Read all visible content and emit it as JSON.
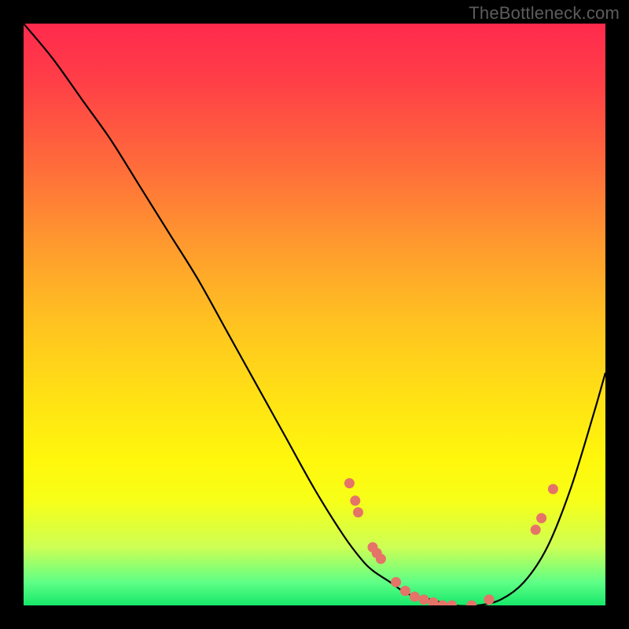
{
  "watermark": "TheBottleneck.com",
  "colors": {
    "background": "#000000",
    "gradient_top": "#ff2a4d",
    "gradient_bottom": "#17e86a",
    "curve": "#000000",
    "dots": "#e57368",
    "watermark_text": "#5c5c5c"
  },
  "chart_data": {
    "type": "line",
    "title": "",
    "xlabel": "",
    "ylabel": "",
    "xlim": [
      0,
      100
    ],
    "ylim": [
      0,
      100
    ],
    "x": [
      0,
      5,
      10,
      15,
      20,
      25,
      30,
      35,
      40,
      45,
      50,
      55,
      58,
      60,
      63,
      66,
      70,
      74,
      78,
      82,
      86,
      90,
      94,
      98,
      100
    ],
    "values": [
      100,
      94,
      87,
      80,
      72,
      64,
      56,
      47,
      38,
      29,
      20,
      12,
      8,
      6,
      4,
      2,
      1,
      0,
      0,
      1,
      4,
      10,
      20,
      33,
      40
    ],
    "highlight_points": [
      {
        "x": 56,
        "y": 21
      },
      {
        "x": 57,
        "y": 18
      },
      {
        "x": 57.5,
        "y": 16
      },
      {
        "x": 60,
        "y": 10
      },
      {
        "x": 60.7,
        "y": 9
      },
      {
        "x": 61.4,
        "y": 8
      },
      {
        "x": 64,
        "y": 4
      },
      {
        "x": 65.6,
        "y": 2.5
      },
      {
        "x": 67.2,
        "y": 1.5
      },
      {
        "x": 68.8,
        "y": 1
      },
      {
        "x": 70.4,
        "y": 0.5
      },
      {
        "x": 72,
        "y": 0
      },
      {
        "x": 73.6,
        "y": 0
      },
      {
        "x": 77,
        "y": 0
      },
      {
        "x": 80,
        "y": 1
      },
      {
        "x": 88,
        "y": 13
      },
      {
        "x": 89,
        "y": 15
      },
      {
        "x": 91,
        "y": 20
      }
    ]
  }
}
